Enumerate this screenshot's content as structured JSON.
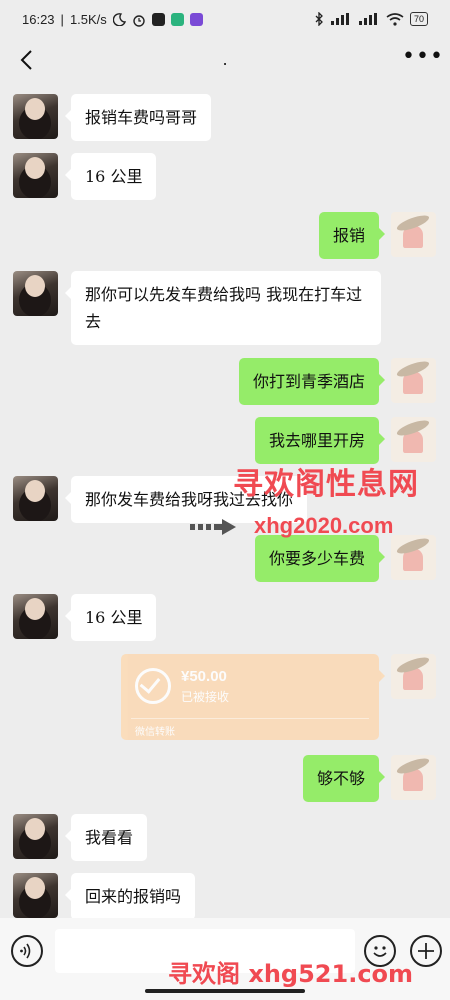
{
  "status_bar": {
    "time": "16:23",
    "speed": "1.5K/s",
    "battery": "70"
  },
  "nav": {
    "title": "."
  },
  "icons": {
    "back": "chevron-left-icon",
    "more": "more-horizontal-icon",
    "voice": "voice-icon",
    "emoji": "emoji-icon",
    "plus": "plus-icon",
    "moon": "moon-icon",
    "alarm": "alarm-icon",
    "bluetooth": "bluetooth-icon",
    "signal": "signal-icon",
    "wifi": "wifi-icon"
  },
  "messages": [
    {
      "side": "left",
      "text": "报销车费吗哥哥"
    },
    {
      "side": "left",
      "text": "16 公里"
    },
    {
      "side": "right",
      "text": "报销"
    },
    {
      "side": "left",
      "text": "那你可以先发车费给我吗  我现在打车过去"
    },
    {
      "side": "right",
      "text": "你打到青季酒店"
    },
    {
      "side": "right",
      "text": "我去哪里开房"
    },
    {
      "side": "left",
      "text": "那你发车费给我呀我过去找你"
    },
    {
      "side": "right",
      "text": "你要多少车费"
    },
    {
      "side": "left",
      "text": "16 公里"
    },
    {
      "side": "right",
      "text": "够不够"
    },
    {
      "side": "left",
      "text": "我看看"
    },
    {
      "side": "left",
      "text": "回来的报销吗"
    }
  ],
  "transfer": {
    "amount": "¥50.00",
    "status": "已被接收",
    "footer": "微信转账"
  },
  "watermarks": {
    "w1": "寻欢阁性息网",
    "w2": "xhg2020.com",
    "w3": "寻欢阁 xhg521.com"
  },
  "colors": {
    "background": "#ededed",
    "bubble_right": "#95ec69",
    "bubble_left": "#ffffff",
    "transfer": "#fcd9b3",
    "watermark": "#f04a52"
  }
}
